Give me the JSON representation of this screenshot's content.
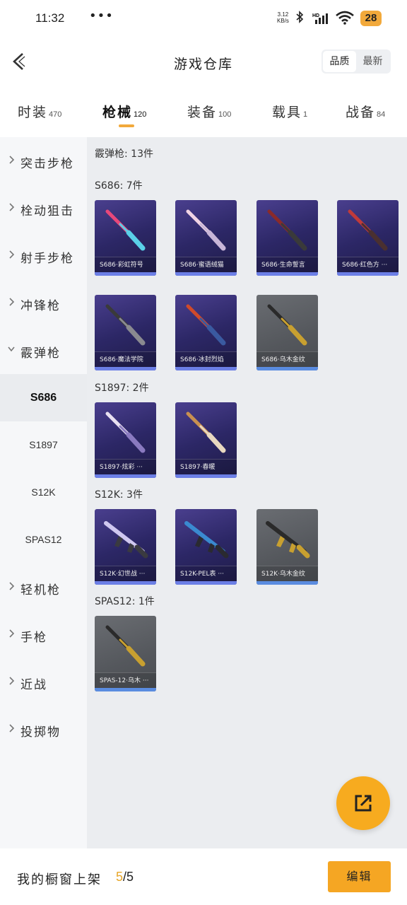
{
  "status_bar": {
    "time": "11:32",
    "dots": "•••",
    "net_speed_value": "3.12",
    "net_speed_unit": "KB/s",
    "battery": "28",
    "icons": [
      "bluetooth-icon",
      "signal-icon",
      "wifi-icon",
      "battery-icon"
    ]
  },
  "header": {
    "title": "游戏仓库",
    "sort_options": [
      "品质",
      "最新"
    ],
    "sort_active": "品质"
  },
  "tabs": [
    {
      "label": "时装",
      "count": "470"
    },
    {
      "label": "枪械",
      "count": "120",
      "active": true
    },
    {
      "label": "装备",
      "count": "100"
    },
    {
      "label": "载具",
      "count": "1"
    },
    {
      "label": "战备",
      "count": "84"
    }
  ],
  "sidebar": {
    "categories": [
      {
        "label": "突击步枪"
      },
      {
        "label": "栓动狙击"
      },
      {
        "label": "射手步枪"
      },
      {
        "label": "冲锋枪"
      },
      {
        "label": "霰弹枪",
        "expanded": true
      },
      {
        "label": "轻机枪"
      },
      {
        "label": "手枪"
      },
      {
        "label": "近战"
      },
      {
        "label": "投掷物"
      }
    ],
    "subcategories": [
      {
        "label": "S686",
        "active": true
      },
      {
        "label": "S1897"
      },
      {
        "label": "S12K"
      },
      {
        "label": "SPAS12"
      }
    ]
  },
  "content": {
    "summary": "霰弹枪: 13件",
    "groups": [
      {
        "heading": "S686: 7件",
        "items": [
          {
            "name": "S686·彩虹符号",
            "display": "S686·彩虹符号",
            "rarity": "purple",
            "colors": [
              "#e8487a",
              "#5ad0e8"
            ]
          },
          {
            "name": "S686·蜜语绒猫",
            "display": "S686·蜜语绒猫",
            "rarity": "purple",
            "colors": [
              "#f0d4e4",
              "#c8b6d8"
            ]
          },
          {
            "name": "S686·生命誓言",
            "display": "S686·生命誓言",
            "rarity": "purple",
            "colors": [
              "#8a2a2a",
              "#3a3a3a"
            ]
          },
          {
            "name": "S686·红色方",
            "display": "S686·红色方 ···",
            "rarity": "purple",
            "colors": [
              "#c03a3a",
              "#4a3030"
            ]
          },
          {
            "name": "S686·魔法学院",
            "display": "S686·魔法学院",
            "rarity": "purple",
            "colors": [
              "#3a3a3a",
              "#8a8a90"
            ]
          },
          {
            "name": "S686·冰封烈焰",
            "display": "S686·冰封烈焰",
            "rarity": "purple",
            "colors": [
              "#d04a2a",
              "#3a5aa0"
            ]
          },
          {
            "name": "S686·乌木金纹",
            "display": "S686·乌木金纹",
            "rarity": "grey",
            "colors": [
              "#2a2a2a",
              "#c8a030"
            ]
          }
        ]
      },
      {
        "heading": "S1897: 2件",
        "items": [
          {
            "name": "S1897·炫彩",
            "display": "S1897·炫彩 ···",
            "rarity": "purple",
            "colors": [
              "#e8e0f0",
              "#8a7ac0"
            ]
          },
          {
            "name": "S1897·春暖",
            "display": "S1897·春暖",
            "rarity": "purple",
            "colors": [
              "#c89050",
              "#e8d8c0"
            ]
          }
        ]
      },
      {
        "heading": "S12K: 3件",
        "items": [
          {
            "name": "S12K·幻世战",
            "display": "S12K·幻世战 ···",
            "rarity": "purple",
            "colors": [
              "#d0c8f0",
              "#3a3a40"
            ]
          },
          {
            "name": "S12K-PEL",
            "display": "S12K-PEL表 ···",
            "rarity": "purple",
            "colors": [
              "#3a8ad0",
              "#2a2a30"
            ]
          },
          {
            "name": "S12K·乌木金纹",
            "display": "S12K·乌木金纹",
            "rarity": "grey",
            "colors": [
              "#2a2a2a",
              "#c8a030"
            ]
          }
        ]
      },
      {
        "heading": "SPAS12: 1件",
        "items": [
          {
            "name": "SPAS-12·乌木",
            "display": "SPAS-12·乌木 ···",
            "rarity": "grey",
            "colors": [
              "#2a2a2a",
              "#c8a030"
            ]
          }
        ]
      }
    ]
  },
  "fab": {
    "icon": "share-external-icon"
  },
  "bottom_bar": {
    "showcase_label": "我的橱窗上架",
    "showcase_current": "5",
    "showcase_total": "/5",
    "edit_label": "编辑"
  },
  "colors": {
    "accent": "#f5a623",
    "card_purple": "#2c2766",
    "card_grey": "#54575c",
    "rarity_bar": "#6c7fe6"
  }
}
